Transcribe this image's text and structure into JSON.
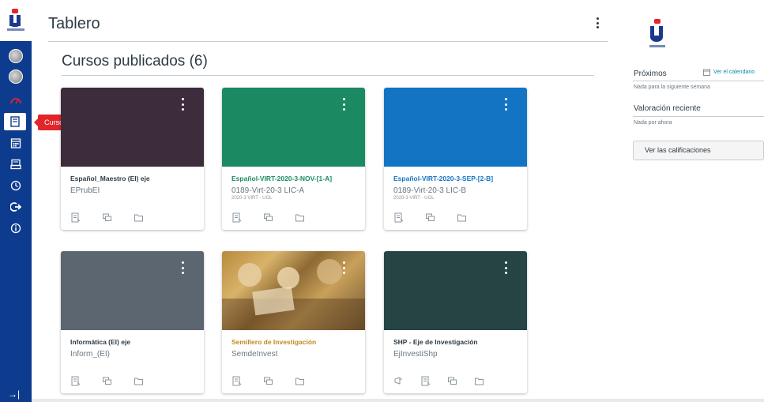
{
  "header": {
    "title": "Tablero"
  },
  "nav": {
    "tooltip": "Cursos",
    "items": [
      {
        "icon": "account-avatar-icon"
      },
      {
        "icon": "profile-avatar-icon"
      },
      {
        "icon": "dashboard-icon"
      },
      {
        "icon": "courses-icon",
        "active": true
      },
      {
        "icon": "calendar-icon"
      },
      {
        "icon": "inbox-icon"
      },
      {
        "icon": "history-icon"
      },
      {
        "icon": "logout-icon"
      },
      {
        "icon": "help-icon"
      }
    ],
    "collapse_glyph": "→|"
  },
  "dashboard": {
    "section_title": "Cursos publicados (6)",
    "courses": [
      {
        "name": "Español_Maestro (EI) eje",
        "code": "EPrubEI",
        "term": "",
        "color": "#3d2c3b",
        "name_color": "#2d3b45",
        "hero": "solid"
      },
      {
        "name": "Español-VIRT-2020-3-NOV-[1-A]",
        "code": "0189-Virt-20-3 LIC-A",
        "term": "2020-3 VIRT - UGL",
        "color": "#1b8a63",
        "name_color": "#1b8a63",
        "hero": "solid"
      },
      {
        "name": "Español-VIRT-2020-3-SEP-[2-B]",
        "code": "0189-Virt-20-3 LIC-B",
        "term": "2020-3 VIRT - UGL",
        "color": "#1474c4",
        "name_color": "#1474c4",
        "hero": "solid"
      },
      {
        "name": "Informática (EI) eje",
        "code": "Inform_(EI)",
        "term": "",
        "color": "#5c6670",
        "name_color": "#2d3b45",
        "hero": "solid"
      },
      {
        "name": "Semillero de Investigación",
        "code": "SemdeInvest",
        "term": "",
        "color": "#b68a3c",
        "name_color": "#c08a1e",
        "hero": "photo"
      },
      {
        "name": "SHP - Eje de Investigación",
        "code": "EjInvestiShp",
        "term": "",
        "color": "#264444",
        "name_color": "#2d3b45",
        "hero": "solid"
      }
    ]
  },
  "sidebar": {
    "upcoming_label": "Próximos",
    "calendar_link": "Ver el calendario",
    "upcoming_empty": "Nada para la siguiente semana",
    "feedback_label": "Valoración reciente",
    "feedback_empty": "Nada por ahora",
    "grades_button": "Ver las calificaciones"
  }
}
